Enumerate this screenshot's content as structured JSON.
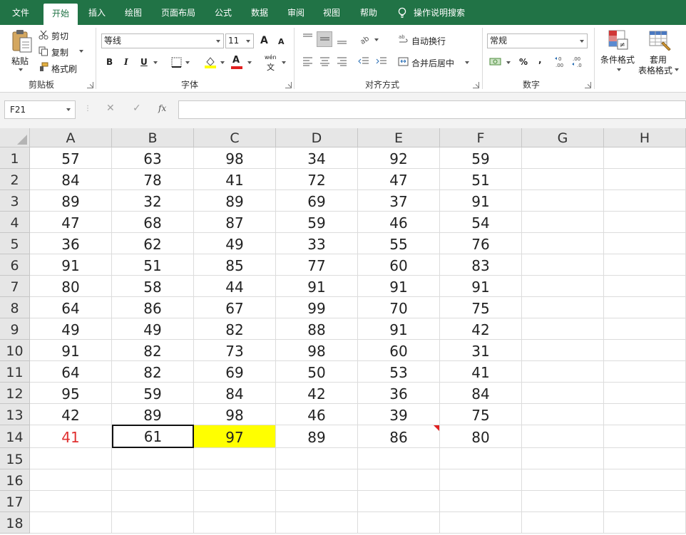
{
  "menu": {
    "tabs": [
      "文件",
      "开始",
      "插入",
      "绘图",
      "页面布局",
      "公式",
      "数据",
      "审阅",
      "视图",
      "帮助"
    ],
    "active_tab": "开始",
    "tell_me": "操作说明搜索"
  },
  "ribbon": {
    "clipboard": {
      "title": "剪贴板",
      "paste": "粘贴",
      "cut": "剪切",
      "copy": "复制",
      "format_painter": "格式刷"
    },
    "font": {
      "title": "字体",
      "font_name": "等线",
      "font_size": "11",
      "bold": "B",
      "italic": "I",
      "underline": "U",
      "grow": "A",
      "shrink": "A",
      "phonetic_top": "wén",
      "phonetic_bottom": "文"
    },
    "alignment": {
      "title": "对齐方式",
      "wrap_text": "自动换行",
      "merge_center": "合并后居中"
    },
    "number": {
      "title": "数字",
      "format": "常规",
      "percent": "%",
      "comma": ","
    },
    "styles": {
      "conditional": "条件格式",
      "format_table_1": "套用",
      "format_table_2": "表格格式"
    }
  },
  "formula_bar": {
    "name_box": "F21",
    "cancel": "✕",
    "enter": "✓",
    "fx": "fx",
    "formula": ""
  },
  "sheet": {
    "columns": [
      "A",
      "B",
      "C",
      "D",
      "E",
      "F",
      "G",
      "H"
    ],
    "rows": [
      [
        "57",
        "63",
        "98",
        "34",
        "92",
        "59",
        "",
        ""
      ],
      [
        "84",
        "78",
        "41",
        "72",
        "47",
        "51",
        "",
        ""
      ],
      [
        "89",
        "32",
        "89",
        "69",
        "37",
        "91",
        "",
        ""
      ],
      [
        "47",
        "68",
        "87",
        "59",
        "46",
        "54",
        "",
        ""
      ],
      [
        "36",
        "62",
        "49",
        "33",
        "55",
        "76",
        "",
        ""
      ],
      [
        "91",
        "51",
        "85",
        "77",
        "60",
        "83",
        "",
        ""
      ],
      [
        "80",
        "58",
        "44",
        "91",
        "91",
        "91",
        "",
        ""
      ],
      [
        "64",
        "86",
        "67",
        "99",
        "70",
        "75",
        "",
        ""
      ],
      [
        "49",
        "49",
        "82",
        "88",
        "91",
        "42",
        "",
        ""
      ],
      [
        "91",
        "82",
        "73",
        "98",
        "60",
        "31",
        "",
        ""
      ],
      [
        "64",
        "82",
        "69",
        "50",
        "53",
        "41",
        "",
        ""
      ],
      [
        "95",
        "59",
        "84",
        "42",
        "36",
        "84",
        "",
        ""
      ],
      [
        "42",
        "89",
        "98",
        "46",
        "39",
        "75",
        "",
        ""
      ],
      [
        "41",
        "61",
        "97",
        "89",
        "86",
        "80",
        "",
        ""
      ],
      [
        "",
        "",
        "",
        "",
        "",
        "",
        "",
        ""
      ],
      [
        "",
        "",
        "",
        "",
        "",
        "",
        "",
        ""
      ],
      [
        "",
        "",
        "",
        "",
        "",
        "",
        "",
        ""
      ],
      [
        "",
        "",
        "",
        "",
        "",
        "",
        "",
        ""
      ]
    ],
    "row_numbers": [
      "1",
      "2",
      "3",
      "4",
      "5",
      "6",
      "7",
      "8",
      "9",
      "10",
      "11",
      "12",
      "13",
      "14",
      "15",
      "16",
      "17",
      "18"
    ],
    "colors": {
      "red_text": "#e03030",
      "highlight": "#ffff00",
      "accent": "#217346"
    }
  }
}
